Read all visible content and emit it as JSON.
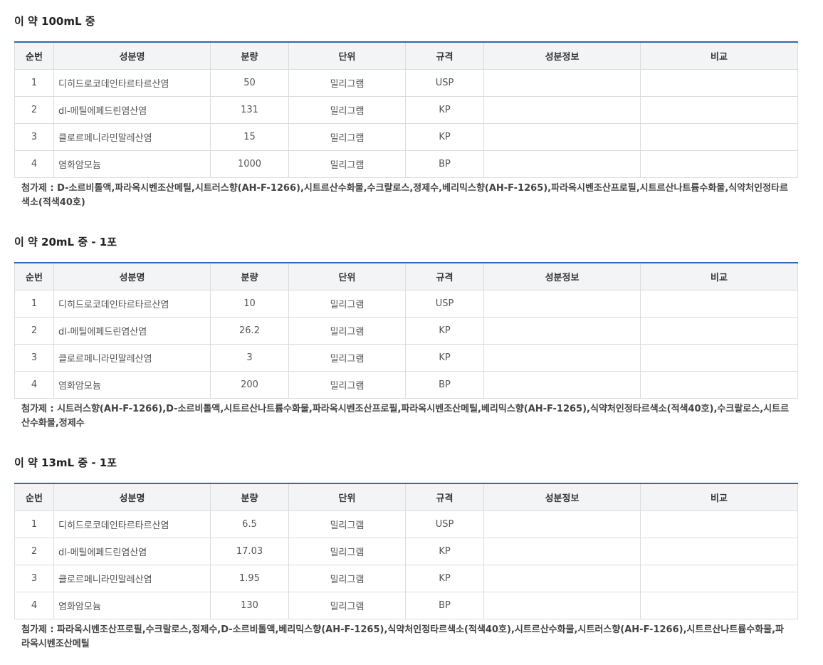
{
  "headers": [
    "순번",
    "성분명",
    "분량",
    "단위",
    "규격",
    "성분정보",
    "비교"
  ],
  "sections": [
    {
      "title": "이 약 100mL 중",
      "rows": [
        {
          "no": "1",
          "name": "디히드로코데인타르타르산염",
          "amount": "50",
          "unit": "밀리그램",
          "spec": "USP",
          "info": "",
          "compare": ""
        },
        {
          "no": "2",
          "name": "dl-메틸에페드린염산염",
          "amount": "131",
          "unit": "밀리그램",
          "spec": "KP",
          "info": "",
          "compare": ""
        },
        {
          "no": "3",
          "name": "클로르페니라민말레산염",
          "amount": "15",
          "unit": "밀리그램",
          "spec": "KP",
          "info": "",
          "compare": ""
        },
        {
          "no": "4",
          "name": "염화암모늄",
          "amount": "1000",
          "unit": "밀리그램",
          "spec": "BP",
          "info": "",
          "compare": ""
        }
      ],
      "additive": "첨가제 : D-소르비톨액,파라옥시벤조산메틸,시트러스향(AH-F-1266),시트르산수화물,수크랄로스,정제수,베리믹스향(AH-F-1265),파라옥시벤조산프로필,시트르산나트륨수화물,식약처인정타르색소(적색40호)"
    },
    {
      "title": "이 약 20mL 중 - 1포",
      "rows": [
        {
          "no": "1",
          "name": "디히드로코데인타르타르산염",
          "amount": "10",
          "unit": "밀리그램",
          "spec": "USP",
          "info": "",
          "compare": ""
        },
        {
          "no": "2",
          "name": "dl-메틸에페드린염산염",
          "amount": "26.2",
          "unit": "밀리그램",
          "spec": "KP",
          "info": "",
          "compare": ""
        },
        {
          "no": "3",
          "name": "클로르페니라민말레산염",
          "amount": "3",
          "unit": "밀리그램",
          "spec": "KP",
          "info": "",
          "compare": ""
        },
        {
          "no": "4",
          "name": "염화암모늄",
          "amount": "200",
          "unit": "밀리그램",
          "spec": "BP",
          "info": "",
          "compare": ""
        }
      ],
      "additive": "첨가제 : 시트러스향(AH-F-1266),D-소르비톨액,시트르산나트륨수화물,파라옥시벤조산프로필,파라옥시벤조산메틸,베리믹스향(AH-F-1265),식약처인정타르색소(적색40호),수크랄로스,시트르산수화물,정제수"
    },
    {
      "title": "이 약 13mL 중 - 1포",
      "rows": [
        {
          "no": "1",
          "name": "디히드로코데인타르타르산염",
          "amount": "6.5",
          "unit": "밀리그램",
          "spec": "USP",
          "info": "",
          "compare": ""
        },
        {
          "no": "2",
          "name": "dl-메틸에페드린염산염",
          "amount": "17.03",
          "unit": "밀리그램",
          "spec": "KP",
          "info": "",
          "compare": ""
        },
        {
          "no": "3",
          "name": "클로르페니라민말레산염",
          "amount": "1.95",
          "unit": "밀리그램",
          "spec": "KP",
          "info": "",
          "compare": ""
        },
        {
          "no": "4",
          "name": "염화암모늄",
          "amount": "130",
          "unit": "밀리그램",
          "spec": "BP",
          "info": "",
          "compare": ""
        }
      ],
      "additive": "첨가제 : 파라옥시벤조산프로필,수크랄로스,정제수,D-소르비톨액,베리믹스향(AH-F-1265),식약처인정타르색소(적색40호),시트르산수화물,시트러스향(AH-F-1266),시트르산나트륨수화물,파라옥시벤조산메틸"
    }
  ]
}
